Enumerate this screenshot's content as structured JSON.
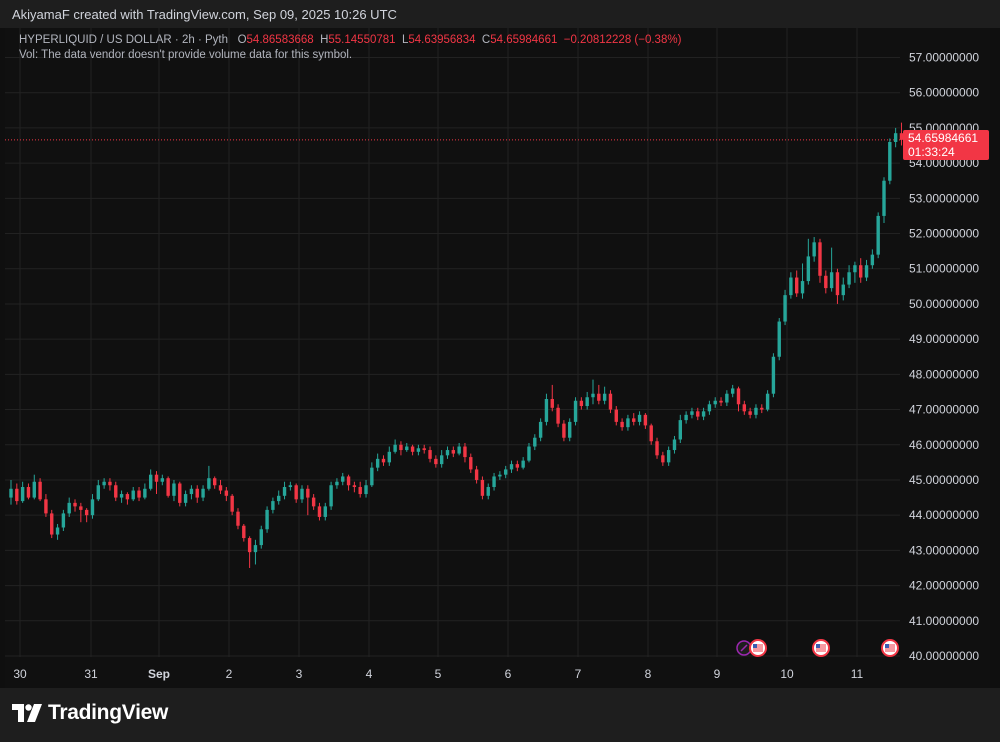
{
  "header": {
    "attribution": "AkiyamaF created with TradingView.com, Sep 09, 2025 10:26 UTC"
  },
  "legend": {
    "symbol": "HYPERLIQUID / US DOLLAR · 2h · Pyth",
    "open_label": "O",
    "open": "54.86583668",
    "high_label": "H",
    "high": "55.14550781",
    "low_label": "L",
    "low": "54.63956834",
    "close_label": "C",
    "close": "54.65984661",
    "change": "−0.20812228 (−0.38%)",
    "volume_note": "Vol: The data vendor doesn't provide volume data for this symbol."
  },
  "price_tag": {
    "price": "54.65984661",
    "countdown": "01:33:24"
  },
  "branding": {
    "logo_text": "TradingView"
  },
  "colors": {
    "up": "#26a69a",
    "down": "#f23645",
    "grid": "#222222",
    "axis_text": "#d1d4dc"
  },
  "chart_data": {
    "type": "candlestick",
    "interval": "2h",
    "ylim": [
      40,
      57
    ],
    "y_ticks": [
      "57.00000000",
      "56.00000000",
      "55.00000000",
      "54.00000000",
      "53.00000000",
      "52.00000000",
      "51.00000000",
      "50.00000000",
      "49.00000000",
      "48.00000000",
      "47.00000000",
      "46.00000000",
      "45.00000000",
      "44.00000000",
      "43.00000000",
      "42.00000000",
      "41.00000000",
      "40.00000000"
    ],
    "x_ticks": [
      "30",
      "31",
      "Sep",
      "2",
      "3",
      "4",
      "5",
      "6",
      "7",
      "8",
      "9",
      "10",
      "11"
    ],
    "last_price_line": 54.66,
    "grid": true,
    "event_markers": [
      "calendar-event",
      "us-flag-event",
      "us-flag-event",
      "us-flag-event"
    ],
    "candles": [
      [
        44.5,
        44.75,
        44.3,
        45.0
      ],
      [
        44.75,
        44.4,
        44.3,
        44.9
      ],
      [
        44.4,
        44.8,
        44.35,
        44.95
      ],
      [
        44.8,
        44.5,
        44.45,
        44.9
      ],
      [
        44.5,
        44.95,
        44.45,
        45.15
      ],
      [
        44.95,
        44.45,
        44.4,
        45.05
      ],
      [
        44.45,
        44.05,
        43.95,
        44.6
      ],
      [
        44.05,
        43.45,
        43.35,
        44.15
      ],
      [
        43.45,
        43.65,
        43.3,
        43.75
      ],
      [
        43.65,
        44.05,
        43.55,
        44.15
      ],
      [
        44.05,
        44.35,
        43.95,
        44.5
      ],
      [
        44.35,
        44.25,
        44.1,
        44.45
      ],
      [
        44.25,
        44.15,
        43.8,
        44.35
      ],
      [
        44.15,
        44.0,
        43.8,
        44.2
      ],
      [
        44.0,
        44.45,
        43.9,
        44.6
      ],
      [
        44.45,
        44.85,
        44.4,
        45.0
      ],
      [
        44.85,
        44.95,
        44.75,
        45.05
      ],
      [
        44.95,
        44.85,
        44.7,
        45.05
      ],
      [
        44.85,
        44.5,
        44.4,
        44.95
      ],
      [
        44.5,
        44.6,
        44.35,
        44.7
      ],
      [
        44.6,
        44.45,
        44.3,
        44.65
      ],
      [
        44.45,
        44.7,
        44.4,
        44.8
      ],
      [
        44.7,
        44.5,
        44.4,
        44.8
      ],
      [
        44.5,
        44.75,
        44.45,
        44.9
      ],
      [
        44.75,
        45.15,
        44.7,
        45.3
      ],
      [
        45.15,
        44.95,
        44.6,
        45.25
      ],
      [
        44.95,
        45.05,
        44.85,
        45.15
      ],
      [
        45.05,
        44.55,
        44.5,
        45.1
      ],
      [
        44.55,
        44.9,
        44.4,
        45.0
      ],
      [
        44.9,
        44.35,
        44.25,
        44.95
      ],
      [
        44.35,
        44.6,
        44.25,
        44.7
      ],
      [
        44.6,
        44.75,
        44.45,
        44.85
      ],
      [
        44.75,
        44.5,
        44.35,
        44.85
      ],
      [
        44.5,
        44.75,
        44.4,
        44.85
      ],
      [
        44.75,
        45.05,
        44.7,
        45.4
      ],
      [
        45.05,
        44.85,
        44.75,
        45.1
      ],
      [
        44.85,
        44.7,
        44.6,
        45.0
      ],
      [
        44.7,
        44.55,
        44.4,
        44.8
      ],
      [
        44.55,
        44.1,
        44.0,
        44.6
      ],
      [
        44.1,
        43.7,
        43.6,
        44.2
      ],
      [
        43.7,
        43.35,
        43.25,
        43.75
      ],
      [
        43.35,
        42.95,
        42.5,
        43.4
      ],
      [
        42.95,
        43.15,
        42.6,
        43.3
      ],
      [
        43.15,
        43.6,
        43.05,
        43.7
      ],
      [
        43.6,
        44.15,
        43.5,
        44.25
      ],
      [
        44.15,
        44.4,
        44.05,
        44.5
      ],
      [
        44.4,
        44.55,
        44.3,
        44.7
      ],
      [
        44.55,
        44.8,
        44.45,
        44.95
      ],
      [
        44.8,
        44.85,
        44.7,
        44.95
      ],
      [
        44.85,
        44.45,
        44.35,
        44.9
      ],
      [
        44.45,
        44.75,
        44.35,
        44.85
      ],
      [
        44.75,
        44.5,
        44.0,
        44.85
      ],
      [
        44.5,
        44.25,
        44.15,
        44.6
      ],
      [
        44.25,
        43.95,
        43.85,
        44.35
      ],
      [
        43.95,
        44.25,
        43.85,
        44.35
      ],
      [
        44.25,
        44.85,
        44.15,
        44.95
      ],
      [
        44.85,
        44.95,
        44.75,
        45.05
      ],
      [
        44.95,
        45.1,
        44.85,
        45.2
      ],
      [
        45.1,
        44.85,
        44.7,
        45.15
      ],
      [
        44.85,
        44.8,
        44.65,
        44.95
      ],
      [
        44.8,
        44.6,
        44.5,
        44.95
      ],
      [
        44.6,
        44.85,
        44.5,
        45.0
      ],
      [
        44.85,
        45.35,
        44.8,
        45.5
      ],
      [
        45.35,
        45.6,
        45.25,
        45.75
      ],
      [
        45.6,
        45.5,
        45.4,
        45.7
      ],
      [
        45.5,
        45.8,
        45.4,
        45.95
      ],
      [
        45.8,
        46.0,
        45.75,
        46.15
      ],
      [
        46.0,
        45.85,
        45.7,
        46.1
      ],
      [
        45.85,
        45.95,
        45.8,
        46.05
      ],
      [
        45.95,
        45.8,
        45.7,
        46.0
      ],
      [
        45.8,
        45.9,
        45.7,
        46.0
      ],
      [
        45.9,
        45.85,
        45.75,
        46.0
      ],
      [
        45.85,
        45.6,
        45.5,
        45.95
      ],
      [
        45.6,
        45.45,
        45.35,
        45.7
      ],
      [
        45.45,
        45.7,
        45.35,
        45.85
      ],
      [
        45.7,
        45.85,
        45.6,
        45.95
      ],
      [
        45.85,
        45.75,
        45.65,
        45.95
      ],
      [
        45.75,
        45.95,
        45.7,
        46.05
      ],
      [
        45.95,
        45.65,
        45.5,
        46.05
      ],
      [
        45.65,
        45.3,
        45.2,
        45.75
      ],
      [
        45.3,
        45.0,
        44.9,
        45.4
      ],
      [
        45.0,
        44.55,
        44.45,
        45.1
      ],
      [
        44.55,
        44.8,
        44.45,
        44.9
      ],
      [
        44.8,
        45.1,
        44.7,
        45.2
      ],
      [
        45.1,
        45.15,
        45.0,
        45.25
      ],
      [
        45.15,
        45.3,
        45.05,
        45.4
      ],
      [
        45.3,
        45.45,
        45.2,
        45.55
      ],
      [
        45.45,
        45.35,
        45.25,
        45.55
      ],
      [
        45.35,
        45.55,
        45.3,
        45.65
      ],
      [
        45.55,
        45.95,
        45.5,
        46.05
      ],
      [
        45.95,
        46.2,
        45.85,
        46.3
      ],
      [
        46.2,
        46.65,
        46.1,
        46.75
      ],
      [
        46.65,
        47.3,
        46.55,
        47.45
      ],
      [
        47.3,
        47.05,
        46.95,
        47.7
      ],
      [
        47.05,
        46.6,
        46.5,
        47.15
      ],
      [
        46.6,
        46.2,
        46.1,
        46.7
      ],
      [
        46.2,
        46.65,
        46.1,
        46.75
      ],
      [
        46.65,
        47.25,
        46.55,
        47.35
      ],
      [
        47.25,
        47.1,
        47.0,
        47.35
      ],
      [
        47.1,
        47.35,
        47.0,
        47.5
      ],
      [
        47.35,
        47.45,
        47.15,
        47.85
      ],
      [
        47.45,
        47.25,
        47.15,
        47.7
      ],
      [
        47.25,
        47.45,
        47.15,
        47.65
      ],
      [
        47.45,
        47.0,
        46.9,
        47.55
      ],
      [
        47.0,
        46.65,
        46.55,
        47.1
      ],
      [
        46.65,
        46.5,
        46.4,
        46.75
      ],
      [
        46.5,
        46.75,
        46.4,
        46.85
      ],
      [
        46.75,
        46.65,
        46.55,
        46.9
      ],
      [
        46.65,
        46.85,
        46.55,
        46.95
      ],
      [
        46.85,
        46.55,
        46.45,
        46.9
      ],
      [
        46.55,
        46.1,
        46.0,
        46.6
      ],
      [
        46.1,
        45.7,
        45.6,
        46.2
      ],
      [
        45.7,
        45.5,
        45.4,
        45.8
      ],
      [
        45.5,
        45.85,
        45.4,
        45.95
      ],
      [
        45.85,
        46.15,
        45.75,
        46.25
      ],
      [
        46.15,
        46.7,
        46.05,
        46.85
      ],
      [
        46.7,
        46.85,
        46.6,
        46.95
      ],
      [
        46.85,
        46.95,
        46.75,
        47.05
      ],
      [
        46.95,
        46.8,
        46.7,
        47.05
      ],
      [
        46.8,
        46.95,
        46.7,
        47.05
      ],
      [
        46.95,
        47.15,
        46.85,
        47.25
      ],
      [
        47.15,
        47.25,
        47.05,
        47.35
      ],
      [
        47.25,
        47.2,
        47.1,
        47.35
      ],
      [
        47.2,
        47.45,
        47.1,
        47.55
      ],
      [
        47.45,
        47.6,
        47.35,
        47.7
      ],
      [
        47.6,
        47.15,
        46.95,
        47.65
      ],
      [
        47.15,
        46.95,
        46.85,
        47.25
      ],
      [
        46.95,
        46.85,
        46.75,
        47.05
      ],
      [
        46.85,
        47.05,
        46.75,
        47.15
      ],
      [
        47.05,
        47.0,
        46.9,
        47.15
      ],
      [
        47.0,
        47.45,
        46.95,
        47.55
      ],
      [
        47.45,
        48.5,
        47.35,
        48.6
      ],
      [
        48.5,
        49.5,
        48.4,
        49.6
      ],
      [
        49.5,
        50.25,
        49.4,
        50.4
      ],
      [
        50.25,
        50.75,
        50.15,
        50.9
      ],
      [
        50.75,
        50.3,
        50.2,
        50.95
      ],
      [
        50.3,
        50.65,
        50.15,
        51.15
      ],
      [
        50.65,
        51.35,
        50.55,
        51.85
      ],
      [
        51.35,
        51.75,
        51.2,
        51.9
      ],
      [
        51.75,
        50.8,
        50.6,
        51.85
      ],
      [
        50.8,
        50.45,
        50.3,
        50.95
      ],
      [
        50.45,
        50.9,
        50.35,
        51.6
      ],
      [
        50.9,
        50.25,
        50.0,
        51.0
      ],
      [
        50.25,
        50.55,
        50.1,
        50.75
      ],
      [
        50.55,
        50.9,
        50.45,
        51.1
      ],
      [
        50.9,
        51.1,
        50.6,
        51.2
      ],
      [
        51.1,
        50.75,
        50.6,
        51.3
      ],
      [
        50.75,
        51.1,
        50.65,
        51.25
      ],
      [
        51.1,
        51.4,
        51.0,
        51.55
      ],
      [
        51.4,
        52.5,
        51.3,
        52.6
      ],
      [
        52.5,
        53.5,
        52.3,
        53.6
      ],
      [
        53.5,
        54.6,
        53.4,
        54.7
      ],
      [
        54.6,
        54.85,
        54.45,
        55.0
      ],
      [
        54.85,
        54.66,
        54.5,
        55.15
      ]
    ]
  }
}
